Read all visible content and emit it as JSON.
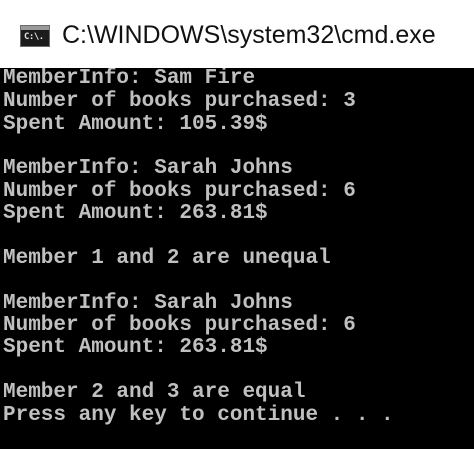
{
  "window": {
    "title": "C:\\WINDOWS\\system32\\cmd.exe",
    "icon": "cmd-icon",
    "icon_glyph": "C:\\."
  },
  "console": {
    "lines": [
      "MemberInfo: Sam Fire",
      "Number of books purchased: 3",
      "Spent Amount: 105.39$",
      "",
      "MemberInfo: Sarah Johns",
      "Number of books purchased: 6",
      "Spent Amount: 263.81$",
      "",
      "Member 1 and 2 are unequal",
      "",
      "MemberInfo: Sarah Johns",
      "Number of books purchased: 6",
      "Spent Amount: 263.81$",
      "",
      "Member 2 and 3 are equal",
      "Press any key to continue . . ."
    ]
  },
  "colors": {
    "console_background": "#000000",
    "console_text": "#c0c0c0",
    "titlebar_background": "#ffffff"
  }
}
